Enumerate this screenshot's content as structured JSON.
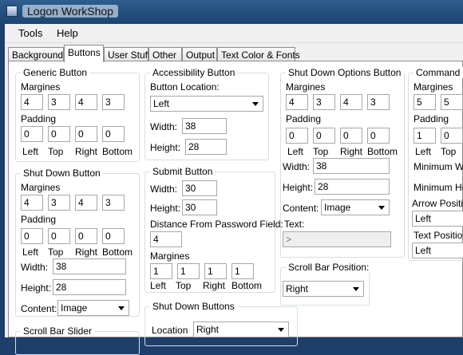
{
  "window": {
    "title": "Logon WorkShop"
  },
  "menu": [
    "Tools",
    "Help"
  ],
  "tabs": [
    "Background",
    "Buttons",
    "User Stuff",
    "Other",
    "Output",
    "Text Color & Fonts"
  ],
  "common": {
    "margines": "Margines",
    "padding": "Padding",
    "left": "Left",
    "top": "Top",
    "right": "Right",
    "bottom": "Bottom",
    "width": "Width:",
    "height": "Height:",
    "content": "Content:"
  },
  "generic_button": {
    "title": "Generic Button",
    "margines": [
      "4",
      "3",
      "4",
      "3"
    ],
    "padding": [
      "0",
      "0",
      "0",
      "0"
    ]
  },
  "shutdown_button": {
    "title": "Shut Down Button",
    "margines": [
      "4",
      "3",
      "4",
      "3"
    ],
    "padding": [
      "0",
      "0",
      "0",
      "0"
    ],
    "width": "38",
    "height": "28",
    "content": "Image"
  },
  "scroll_bar_slider": {
    "title": "Scroll Bar Slider"
  },
  "accessibility_button": {
    "title": "Accessibility Button",
    "location_label": "Button Location:",
    "location": "Left",
    "width": "38",
    "height": "28"
  },
  "submit_button": {
    "title": "Submit Button",
    "width": "30",
    "height": "30",
    "distance_label": "Distance From Password Field:",
    "distance": "4",
    "margines": [
      "1",
      "1",
      "1",
      "1"
    ]
  },
  "shutdown_buttons": {
    "title": "Shut Down Buttons",
    "location_label": "Location",
    "location": "Right"
  },
  "shutdown_options_button": {
    "title": "Shut Down Options Button",
    "margines": [
      "4",
      "3",
      "4",
      "3"
    ],
    "padding": [
      "0",
      "0",
      "0",
      "0"
    ],
    "width": "38",
    "height": "28",
    "content": "Image",
    "text_label": "Text:",
    "text": ">"
  },
  "scroll_bar_position": {
    "title": "Scroll Bar Position:",
    "value": "Right"
  },
  "command_button": {
    "title": "Command Bu",
    "margines": [
      "5",
      "5"
    ],
    "padding": [
      "1",
      "0"
    ],
    "min_width_label": "Minimum Widt",
    "min_height_label": "Minimum Heig",
    "arrow_position_label": "Arrow Position",
    "arrow_position": "Left",
    "text_position_label": "Text Position",
    "text_position": "Left"
  }
}
